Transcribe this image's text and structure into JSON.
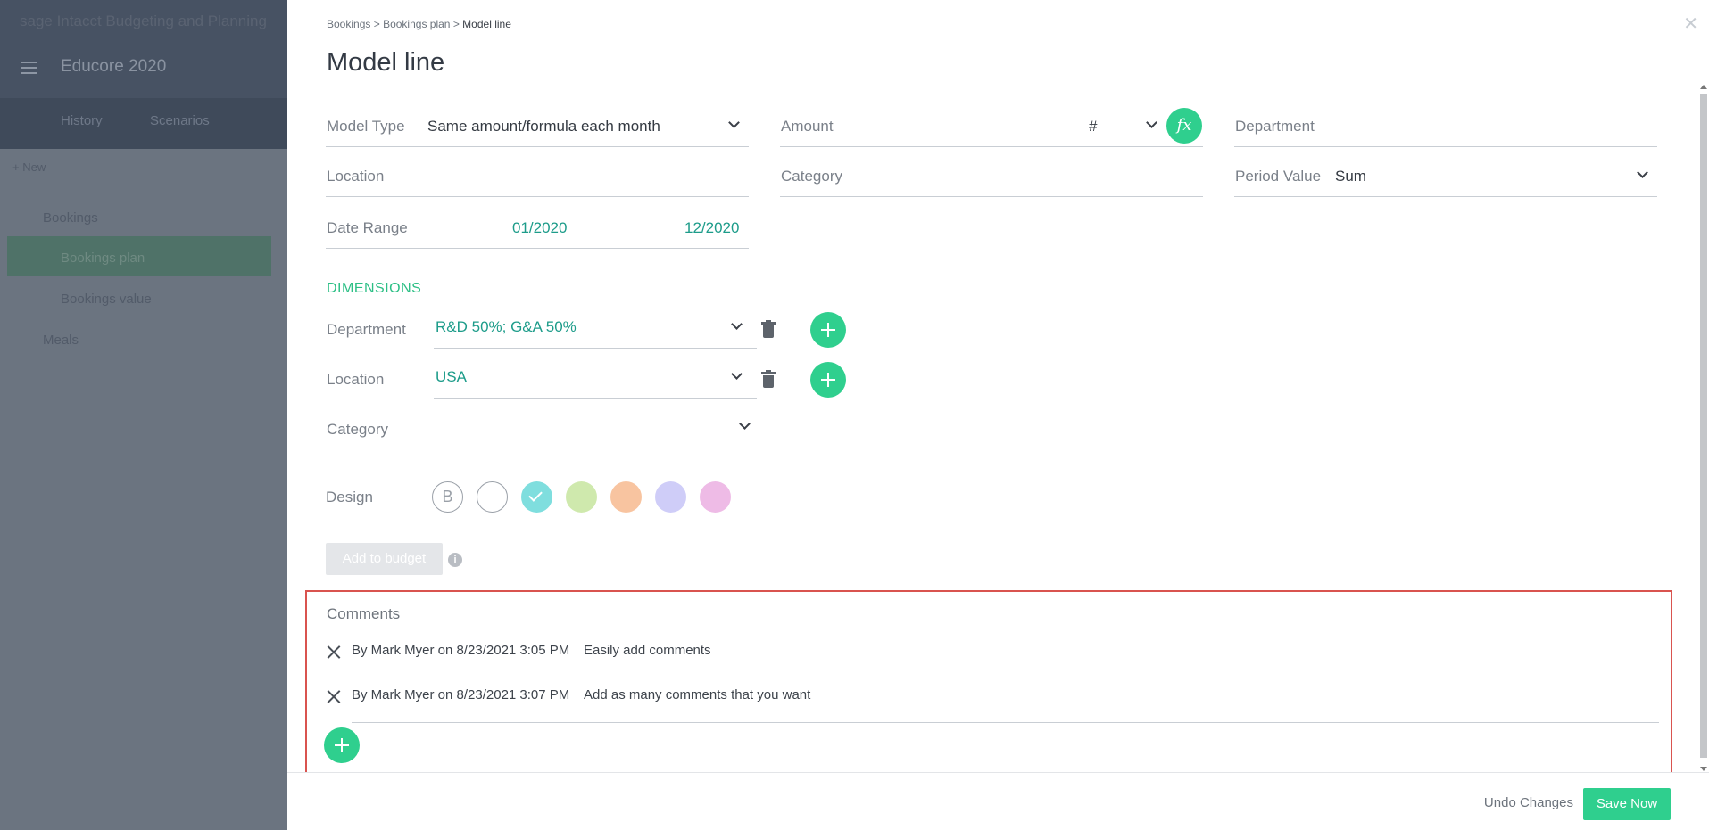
{
  "background": {
    "brand": "sage Intacct Budgeting and Planning",
    "title": "Educore 2020",
    "tabs": [
      "History",
      "Scenarios"
    ],
    "new_label": "+ New",
    "tree": {
      "group": "Bookings",
      "items": [
        "Bookings plan",
        "Bookings value"
      ],
      "other": "Meals"
    }
  },
  "breadcrumb": {
    "items": [
      "Bookings",
      "Bookings plan"
    ],
    "current": "Model line",
    "separator": ">"
  },
  "page_title": "Model line",
  "fields": {
    "model_type": {
      "label": "Model Type",
      "value": "Same amount/formula each month"
    },
    "amount": {
      "label": "Amount",
      "unit": "#",
      "fx": "fx"
    },
    "department": {
      "label": "Department",
      "value": ""
    },
    "location": {
      "label": "Location",
      "value": ""
    },
    "category": {
      "label": "Category",
      "value": ""
    },
    "period_value": {
      "label": "Period Value",
      "value": "Sum"
    },
    "date_range": {
      "label": "Date Range",
      "start": "01/2020",
      "end": "12/2020"
    }
  },
  "dimensions": {
    "heading": "DIMENSIONS",
    "rows": [
      {
        "label": "Department",
        "value": "R&D 50%; G&A 50%"
      },
      {
        "label": "Location",
        "value": "USA"
      },
      {
        "label": "Category",
        "value": ""
      }
    ]
  },
  "design": {
    "label": "Design",
    "swatches": [
      {
        "name": "bold",
        "text": "B",
        "color": "#ffffff"
      },
      {
        "name": "white",
        "color": "#ffffff"
      },
      {
        "name": "teal",
        "color": "#7fdede",
        "selected": true
      },
      {
        "name": "green",
        "color": "#cfe9ad"
      },
      {
        "name": "orange",
        "color": "#f8c4a0"
      },
      {
        "name": "lavender",
        "color": "#cfcdf8"
      },
      {
        "name": "pink",
        "color": "#eebbe6"
      }
    ]
  },
  "add_to_budget": "Add to budget",
  "info": "i",
  "comments": {
    "title": "Comments",
    "items": [
      {
        "meta": "By Mark Myer on 8/23/2021 3:05 PM",
        "text": "Easily add comments"
      },
      {
        "meta": "By Mark Myer on 8/23/2021 3:07 PM",
        "text": "Add as many comments that you want"
      }
    ]
  },
  "footer": {
    "undo": "Undo Changes",
    "save": "Save Now"
  },
  "colors": {
    "accent": "#2fcf8e",
    "teal_text": "#1d9c8a",
    "highlight_border": "#d9534f"
  }
}
